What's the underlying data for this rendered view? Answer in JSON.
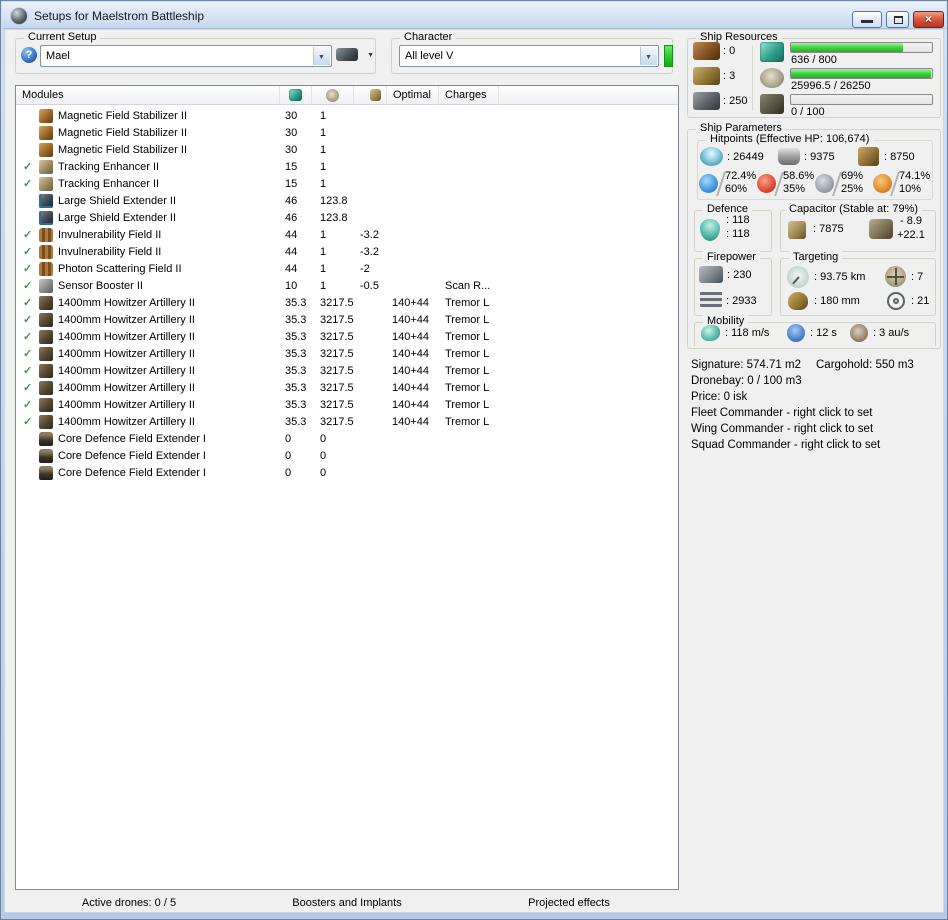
{
  "window": {
    "title": "Setups for Maelstrom Battleship"
  },
  "setup": {
    "group_label": "Current Setup",
    "value": "Mael"
  },
  "character": {
    "group_label": "Character",
    "value": "All level V"
  },
  "resources": {
    "group_label": "Ship Resources",
    "slots": [
      {
        "icon": "turret-hardpoint-icon",
        "value": ": 0"
      },
      {
        "icon": "launcher-hardpoint-icon",
        "value": ": 3"
      },
      {
        "icon": "calibration-icon",
        "value": ": 250"
      }
    ],
    "bars": [
      {
        "icon": "cpu-icon",
        "text": "636 / 800",
        "pct": 79.5
      },
      {
        "icon": "powergrid-icon",
        "text": "25996.5 / 26250",
        "pct": 99
      },
      {
        "icon": "drone-bandwidth-icon",
        "text": "0 / 100",
        "pct": 0
      }
    ]
  },
  "modules": {
    "headers": {
      "name": "Modules",
      "optimal": "Optimal",
      "charges": "Charges"
    },
    "rows": [
      {
        "active": false,
        "icon": "magnetic-field-stabilizer-icon",
        "name": "Magnetic Field Stabilizer II",
        "cpu": "30",
        "pg": "1",
        "cap": "",
        "optimal": "",
        "charges": ""
      },
      {
        "active": false,
        "icon": "magnetic-field-stabilizer-icon",
        "name": "Magnetic Field Stabilizer II",
        "cpu": "30",
        "pg": "1",
        "cap": "",
        "optimal": "",
        "charges": ""
      },
      {
        "active": false,
        "icon": "magnetic-field-stabilizer-icon",
        "name": "Magnetic Field Stabilizer II",
        "cpu": "30",
        "pg": "1",
        "cap": "",
        "optimal": "",
        "charges": ""
      },
      {
        "active": true,
        "icon": "tracking-enhancer-icon",
        "name": "Tracking Enhancer II",
        "cpu": "15",
        "pg": "1",
        "cap": "",
        "optimal": "",
        "charges": ""
      },
      {
        "active": true,
        "icon": "tracking-enhancer-icon",
        "name": "Tracking Enhancer II",
        "cpu": "15",
        "pg": "1",
        "cap": "",
        "optimal": "",
        "charges": ""
      },
      {
        "active": false,
        "icon": "shield-extender-icon",
        "name": "Large Shield Extender II",
        "cpu": "46",
        "pg": "123.8",
        "cap": "",
        "optimal": "",
        "charges": ""
      },
      {
        "active": false,
        "icon": "shield-extender-icon",
        "name": "Large Shield Extender II",
        "cpu": "46",
        "pg": "123.8",
        "cap": "",
        "optimal": "",
        "charges": ""
      },
      {
        "active": true,
        "icon": "shield-hardener-icon",
        "name": "Invulnerability Field II",
        "cpu": "44",
        "pg": "1",
        "cap": "-3.2",
        "optimal": "",
        "charges": ""
      },
      {
        "active": true,
        "icon": "shield-hardener-icon",
        "name": "Invulnerability Field II",
        "cpu": "44",
        "pg": "1",
        "cap": "-3.2",
        "optimal": "",
        "charges": ""
      },
      {
        "active": true,
        "icon": "shield-hardener-icon",
        "name": "Photon Scattering Field II",
        "cpu": "44",
        "pg": "1",
        "cap": "-2",
        "optimal": "",
        "charges": ""
      },
      {
        "active": true,
        "icon": "sensor-booster-icon",
        "name": "Sensor Booster II",
        "cpu": "10",
        "pg": "1",
        "cap": "-0.5",
        "optimal": "",
        "charges": "Scan R..."
      },
      {
        "active": true,
        "icon": "artillery-icon",
        "name": "1400mm Howitzer Artillery II",
        "cpu": "35.3",
        "pg": "3217.5",
        "cap": "",
        "optimal": "140+44",
        "charges": "Tremor L"
      },
      {
        "active": true,
        "icon": "artillery-icon",
        "name": "1400mm Howitzer Artillery II",
        "cpu": "35.3",
        "pg": "3217.5",
        "cap": "",
        "optimal": "140+44",
        "charges": "Tremor L"
      },
      {
        "active": true,
        "icon": "artillery-icon",
        "name": "1400mm Howitzer Artillery II",
        "cpu": "35.3",
        "pg": "3217.5",
        "cap": "",
        "optimal": "140+44",
        "charges": "Tremor L"
      },
      {
        "active": true,
        "icon": "artillery-icon",
        "name": "1400mm Howitzer Artillery II",
        "cpu": "35.3",
        "pg": "3217.5",
        "cap": "",
        "optimal": "140+44",
        "charges": "Tremor L"
      },
      {
        "active": true,
        "icon": "artillery-icon",
        "name": "1400mm Howitzer Artillery II",
        "cpu": "35.3",
        "pg": "3217.5",
        "cap": "",
        "optimal": "140+44",
        "charges": "Tremor L"
      },
      {
        "active": true,
        "icon": "artillery-icon",
        "name": "1400mm Howitzer Artillery II",
        "cpu": "35.3",
        "pg": "3217.5",
        "cap": "",
        "optimal": "140+44",
        "charges": "Tremor L"
      },
      {
        "active": true,
        "icon": "artillery-icon",
        "name": "1400mm Howitzer Artillery II",
        "cpu": "35.3",
        "pg": "3217.5",
        "cap": "",
        "optimal": "140+44",
        "charges": "Tremor L"
      },
      {
        "active": true,
        "icon": "artillery-icon",
        "name": "1400mm Howitzer Artillery II",
        "cpu": "35.3",
        "pg": "3217.5",
        "cap": "",
        "optimal": "140+44",
        "charges": "Tremor L"
      },
      {
        "active": false,
        "icon": "rig-icon",
        "name": "Core Defence Field Extender I",
        "cpu": "0",
        "pg": "0",
        "cap": "",
        "optimal": "",
        "charges": ""
      },
      {
        "active": false,
        "icon": "rig-icon",
        "name": "Core Defence Field Extender I",
        "cpu": "0",
        "pg": "0",
        "cap": "",
        "optimal": "",
        "charges": ""
      },
      {
        "active": false,
        "icon": "rig-icon",
        "name": "Core Defence Field Extender I",
        "cpu": "0",
        "pg": "0",
        "cap": "",
        "optimal": "",
        "charges": ""
      }
    ]
  },
  "parameters": {
    "group_label": "Ship Parameters",
    "hitpoints": {
      "label": "Hitpoints (Effective HP: 106,674)",
      "shield": ": 26449",
      "armor": ": 9375",
      "structure": ": 8750",
      "resists": [
        {
          "icon": "em-resist-icon",
          "shield_pct": "72.4%",
          "armor_pct": "60%"
        },
        {
          "icon": "thermal-resist-icon",
          "shield_pct": "58.6%",
          "armor_pct": "35%"
        },
        {
          "icon": "kinetic-resist-icon",
          "shield_pct": "69%",
          "armor_pct": "25%"
        },
        {
          "icon": "explosive-resist-icon",
          "shield_pct": "74.1%",
          "armor_pct": "10%"
        }
      ]
    },
    "defence": {
      "label": "Defence",
      "line1": ": 118",
      "line2": ": 118"
    },
    "capacitor": {
      "label": "Capacitor (Stable at: 79%)",
      "amount": ": 7875",
      "drain": "- 8.9",
      "recharge": "+22.1"
    },
    "firepower": {
      "label": "Firepower",
      "volley": ": 230",
      "dps": ": 2933"
    },
    "targeting": {
      "label": "Targeting",
      "range": ": 93.75 km",
      "max_targets": ": 7",
      "scan_res": ": 180 mm",
      "sensor_strength": ": 21"
    },
    "mobility": {
      "label": "Mobility",
      "speed": ": 118 m/s",
      "align_time": ": 12 s",
      "warp_speed": ": 3 au/s"
    },
    "info": {
      "signature": "Signature: 574.71 m2",
      "cargohold": "Cargohold: 550 m3",
      "lines": [
        {
          "text": "Dronebay: 0 / 100 m3",
          "interactable": false
        },
        {
          "text": "Price: 0 isk",
          "interactable": false
        },
        {
          "text": "Fleet Commander - right click to set",
          "interactable": true
        },
        {
          "text": "Wing Commander - right click to set",
          "interactable": true
        },
        {
          "text": "Squad Commander - right click to set",
          "interactable": true
        }
      ]
    }
  },
  "bottom": {
    "drones": "Active drones: 0 / 5",
    "boosters": "Boosters and Implants",
    "projected": "Projected effects"
  }
}
